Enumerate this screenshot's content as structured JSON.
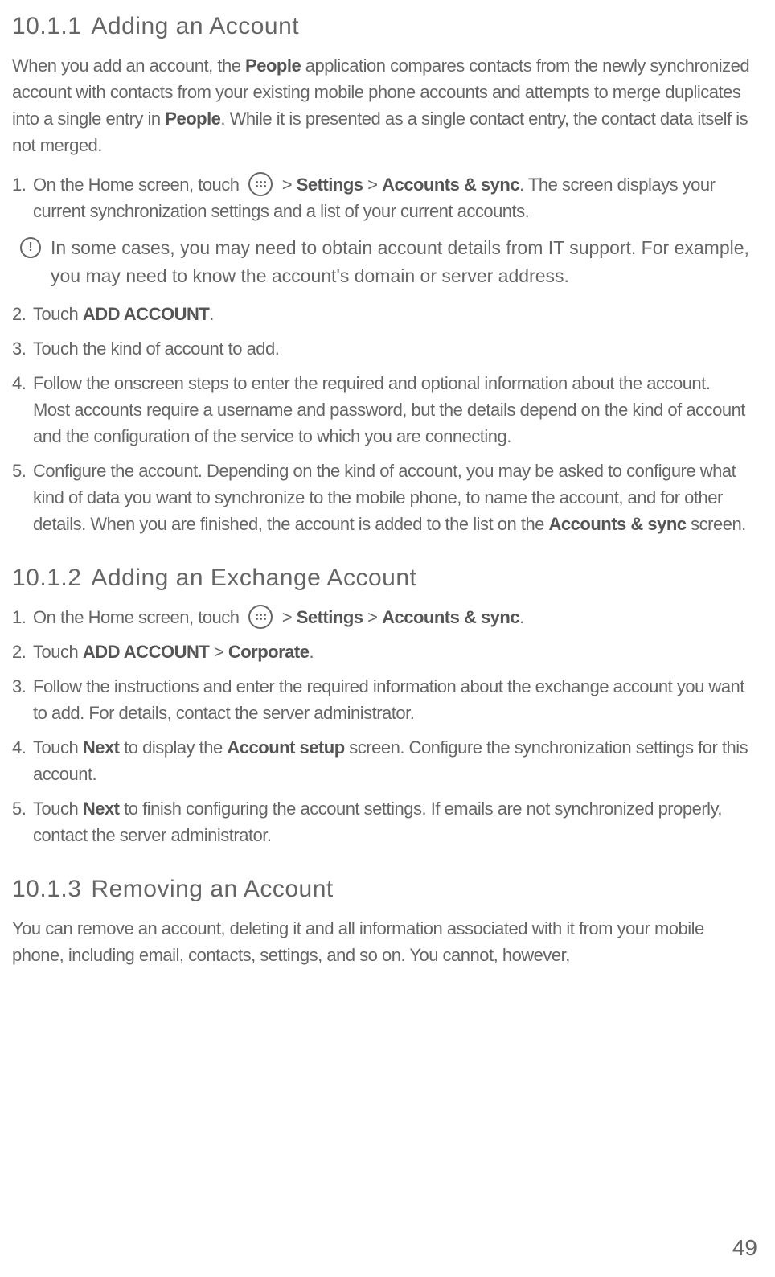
{
  "s1": {
    "num": "10.1.1",
    "title": "Adding an Account",
    "intro_1a": "When you add an account, the ",
    "intro_1b": "People",
    "intro_1c": " application compares contacts from the newly synchronized account with contacts from your existing mobile phone accounts and attempts to merge duplicates into a single entry in ",
    "intro_1d": "People",
    "intro_1e": ". While it is presented as a single contact entry, the contact data itself is not merged.",
    "step1_a": "On the Home screen, touch ",
    "step1_b": " > ",
    "step1_c": "Settings",
    "step1_d": " > ",
    "step1_e": "Accounts & sync",
    "step1_f": ". The screen displays your current synchronization settings and a list of your current accounts.",
    "note": "In some cases, you may need to obtain account details from IT support. For example, you may need to know the account's domain or server address.",
    "step2_a": "Touch ",
    "step2_b": "ADD ACCOUNT",
    "step2_c": ".",
    "step3": "Touch the kind of account to add.",
    "step4": "Follow the onscreen steps to enter the required and optional information about the account. Most accounts require a username and password, but the details depend on the kind of account and the configuration of the service to which you are connecting.",
    "step5_a": "Configure the account. Depending on the kind of account, you may be asked to configure what kind of data you want to synchronize to the mobile phone, to name the account, and for other details. When you are finished, the account is added to the list on the ",
    "step5_b": "Accounts & sync",
    "step5_c": " screen."
  },
  "s2": {
    "num": "10.1.2",
    "title": "Adding an Exchange Account",
    "step1_a": "On the Home screen, touch ",
    "step1_b": " > ",
    "step1_c": "Settings",
    "step1_d": " > ",
    "step1_e": "Accounts & sync",
    "step1_f": ".",
    "step2_a": "Touch ",
    "step2_b": "ADD ACCOUNT",
    "step2_c": " > ",
    "step2_d": "Corporate",
    "step2_e": ".",
    "step3": "Follow the instructions and enter the required information about the exchange account you want to add. For details, contact the server administrator.",
    "step4_a": "Touch ",
    "step4_b": "Next",
    "step4_c": " to display the ",
    "step4_d": "Account setup",
    "step4_e": " screen. Configure the synchronization settings for this account.",
    "step5_a": "Touch ",
    "step5_b": "Next",
    "step5_c": " to finish configuring the account settings. If emails are not synchronized properly, contact the server administrator."
  },
  "s3": {
    "num": "10.1.3",
    "title": "Removing an Account",
    "intro": "You can remove an account, deleting it and all information associated with it from your mobile phone, including email, contacts, settings, and so on. You cannot, however,"
  },
  "page_number": "49",
  "note_icon_glyph": "!"
}
